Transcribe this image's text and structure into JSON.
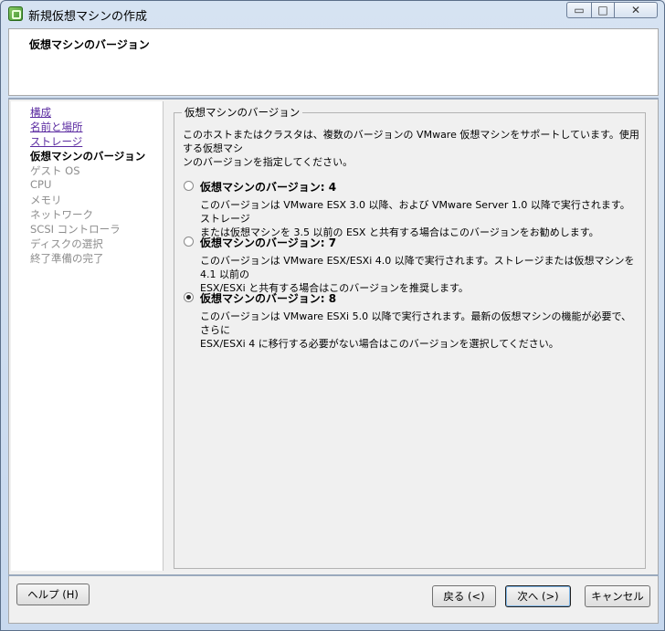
{
  "window": {
    "title": "新規仮想マシンの作成",
    "controls": {
      "minimize": "▭",
      "maximize": "□",
      "close": "✕"
    }
  },
  "header": {
    "title": "仮想マシンのバージョン"
  },
  "steps": [
    {
      "label": "構成",
      "state": "link"
    },
    {
      "label": "名前と場所",
      "state": "link"
    },
    {
      "label": "ストレージ",
      "state": "link"
    },
    {
      "label": "仮想マシンのバージョン",
      "state": "current"
    },
    {
      "label": "ゲスト OS",
      "state": "pending"
    },
    {
      "label": "CPU",
      "state": "pending"
    },
    {
      "label": "メモリ",
      "state": "pending"
    },
    {
      "label": "ネットワーク",
      "state": "pending"
    },
    {
      "label": "SCSI コントローラ",
      "state": "pending"
    },
    {
      "label": "ディスクの選択",
      "state": "pending"
    },
    {
      "label": "終了準備の完了",
      "state": "pending"
    }
  ],
  "main": {
    "group_label": "仮想マシンのバージョン",
    "intro_line1": "このホストまたはクラスタは、複数のバージョンの VMware 仮想マシンをサポートしています。使用する仮想マシ",
    "intro_line2": "ンのバージョンを指定してください。",
    "options": [
      {
        "label": "仮想マシンのバージョン: 4",
        "desc1": "このバージョンは VMware ESX 3.0 以降、および VMware Server 1.0 以降で実行されます。ストレージ",
        "desc2": "または仮想マシンを 3.5 以前の ESX と共有する場合はこのバージョンをお勧めします。",
        "checked": false
      },
      {
        "label": "仮想マシンのバージョン: 7",
        "desc1": "このバージョンは VMware ESX/ESXi 4.0 以降で実行されます。ストレージまたは仮想マシンを 4.1 以前の",
        "desc2": "ESX/ESXi と共有する場合はこのバージョンを推奨します。",
        "checked": false
      },
      {
        "label": "仮想マシンのバージョン: 8",
        "desc1": "このバージョンは VMware ESXi 5.0 以降で実行されます。最新の仮想マシンの機能が必要で、さらに",
        "desc2": "ESX/ESXi 4 に移行する必要がない場合はこのバージョンを選択してください。",
        "checked": true
      }
    ]
  },
  "footer": {
    "help": "ヘルプ (H)",
    "back": "戻る (<)",
    "next": "次へ (>)",
    "cancel": "キャンセル"
  }
}
